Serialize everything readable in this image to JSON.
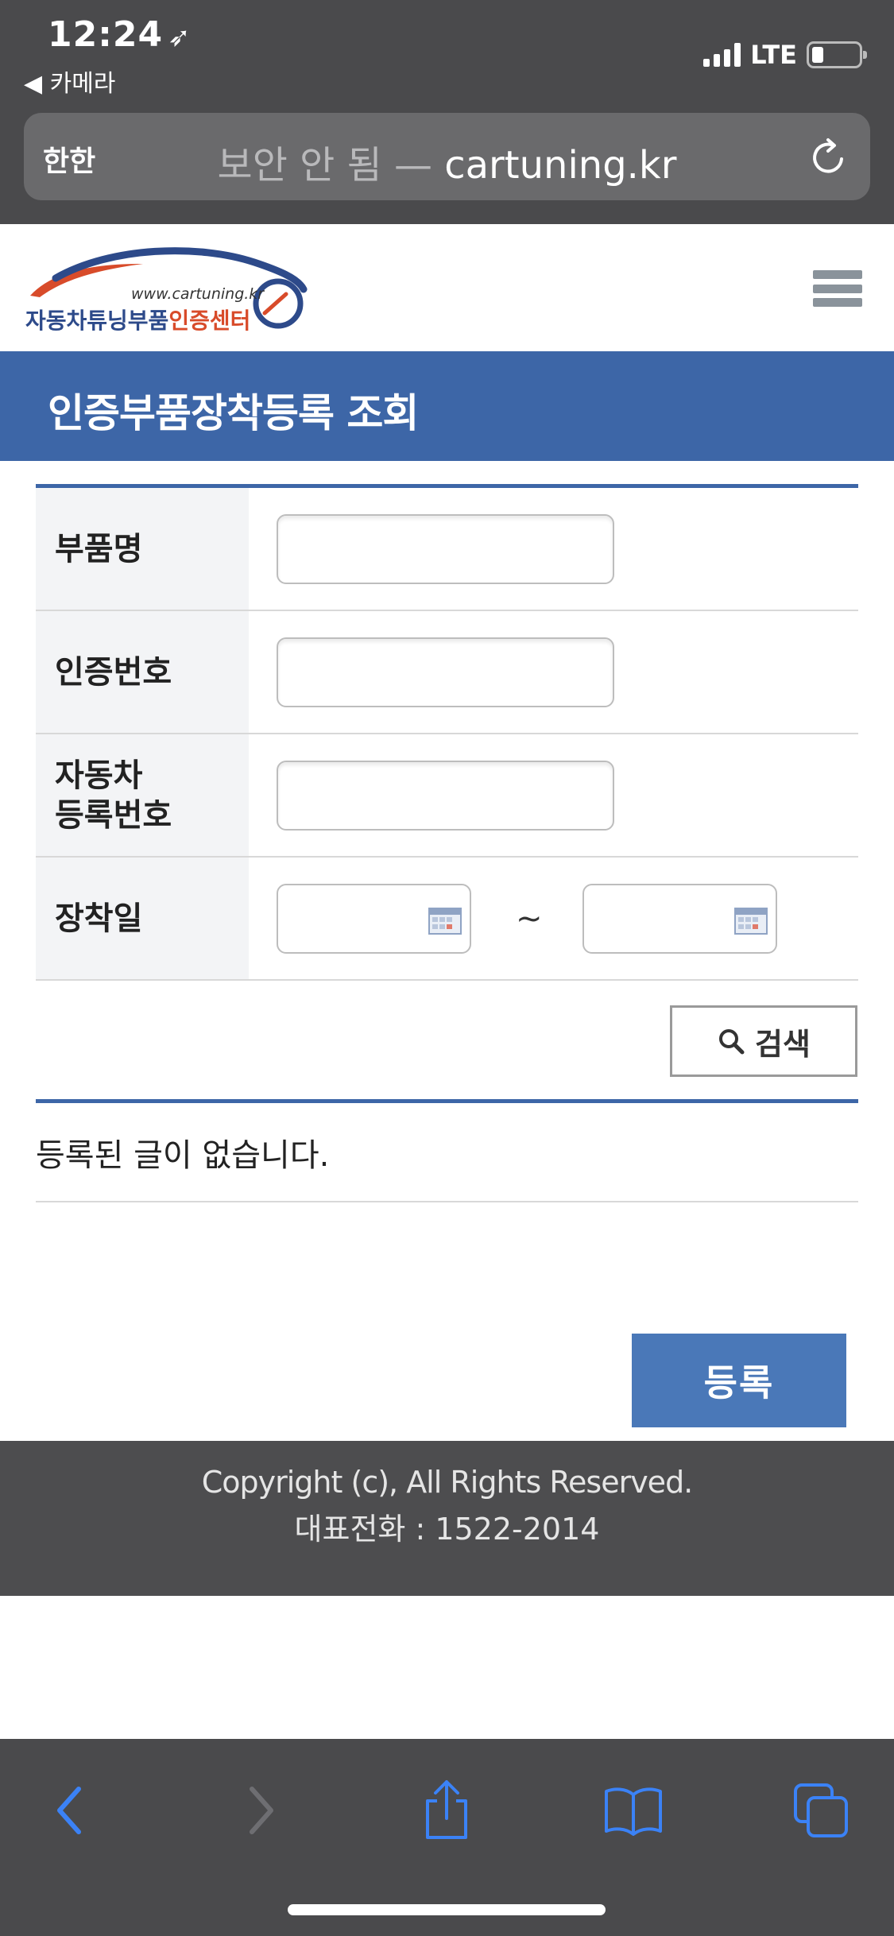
{
  "status_bar": {
    "time": "12:24",
    "location_glyph": "➶",
    "back_app": "◀ 카메라",
    "network": "LTE"
  },
  "address_bar": {
    "reader_label": "한한",
    "security": "보안 안 됨 —",
    "domain": "cartuning.kr"
  },
  "logo": {
    "url_text": "www.cartuning.kr",
    "name_main": "자동차튜닝부품",
    "name_accent": "인증센터"
  },
  "page": {
    "title": "인증부품장착등록 조회"
  },
  "search_form": {
    "part_name_label": "부품명",
    "part_name_value": "",
    "cert_number_label": "인증번호",
    "cert_number_value": "",
    "vehicle_reg_label_line1": "자동차",
    "vehicle_reg_label_line2": "등록번호",
    "vehicle_reg_value": "",
    "install_date_label": "장착일",
    "date_from": "",
    "date_to": "",
    "range_separator": "~",
    "search_button": "검색"
  },
  "results": {
    "empty_message": "등록된 글이 없습니다."
  },
  "actions": {
    "register_button": "등록"
  },
  "footer": {
    "copyright": "Copyright (c), All Rights Reserved.",
    "phone": "대표전화 : 1522-2014"
  },
  "colors": {
    "brand_blue": "#3d66a7",
    "button_blue": "#4a78b8",
    "logo_orange": "#d84b2a",
    "safari_tint": "#3b82f6"
  },
  "icons": [
    "location-arrow-icon",
    "signal-icon",
    "battery-icon",
    "reload-icon",
    "hamburger-menu-icon",
    "calendar-icon",
    "search-icon",
    "back-arrow-icon",
    "forward-arrow-icon",
    "share-icon",
    "bookmarks-icon",
    "tabs-icon"
  ]
}
